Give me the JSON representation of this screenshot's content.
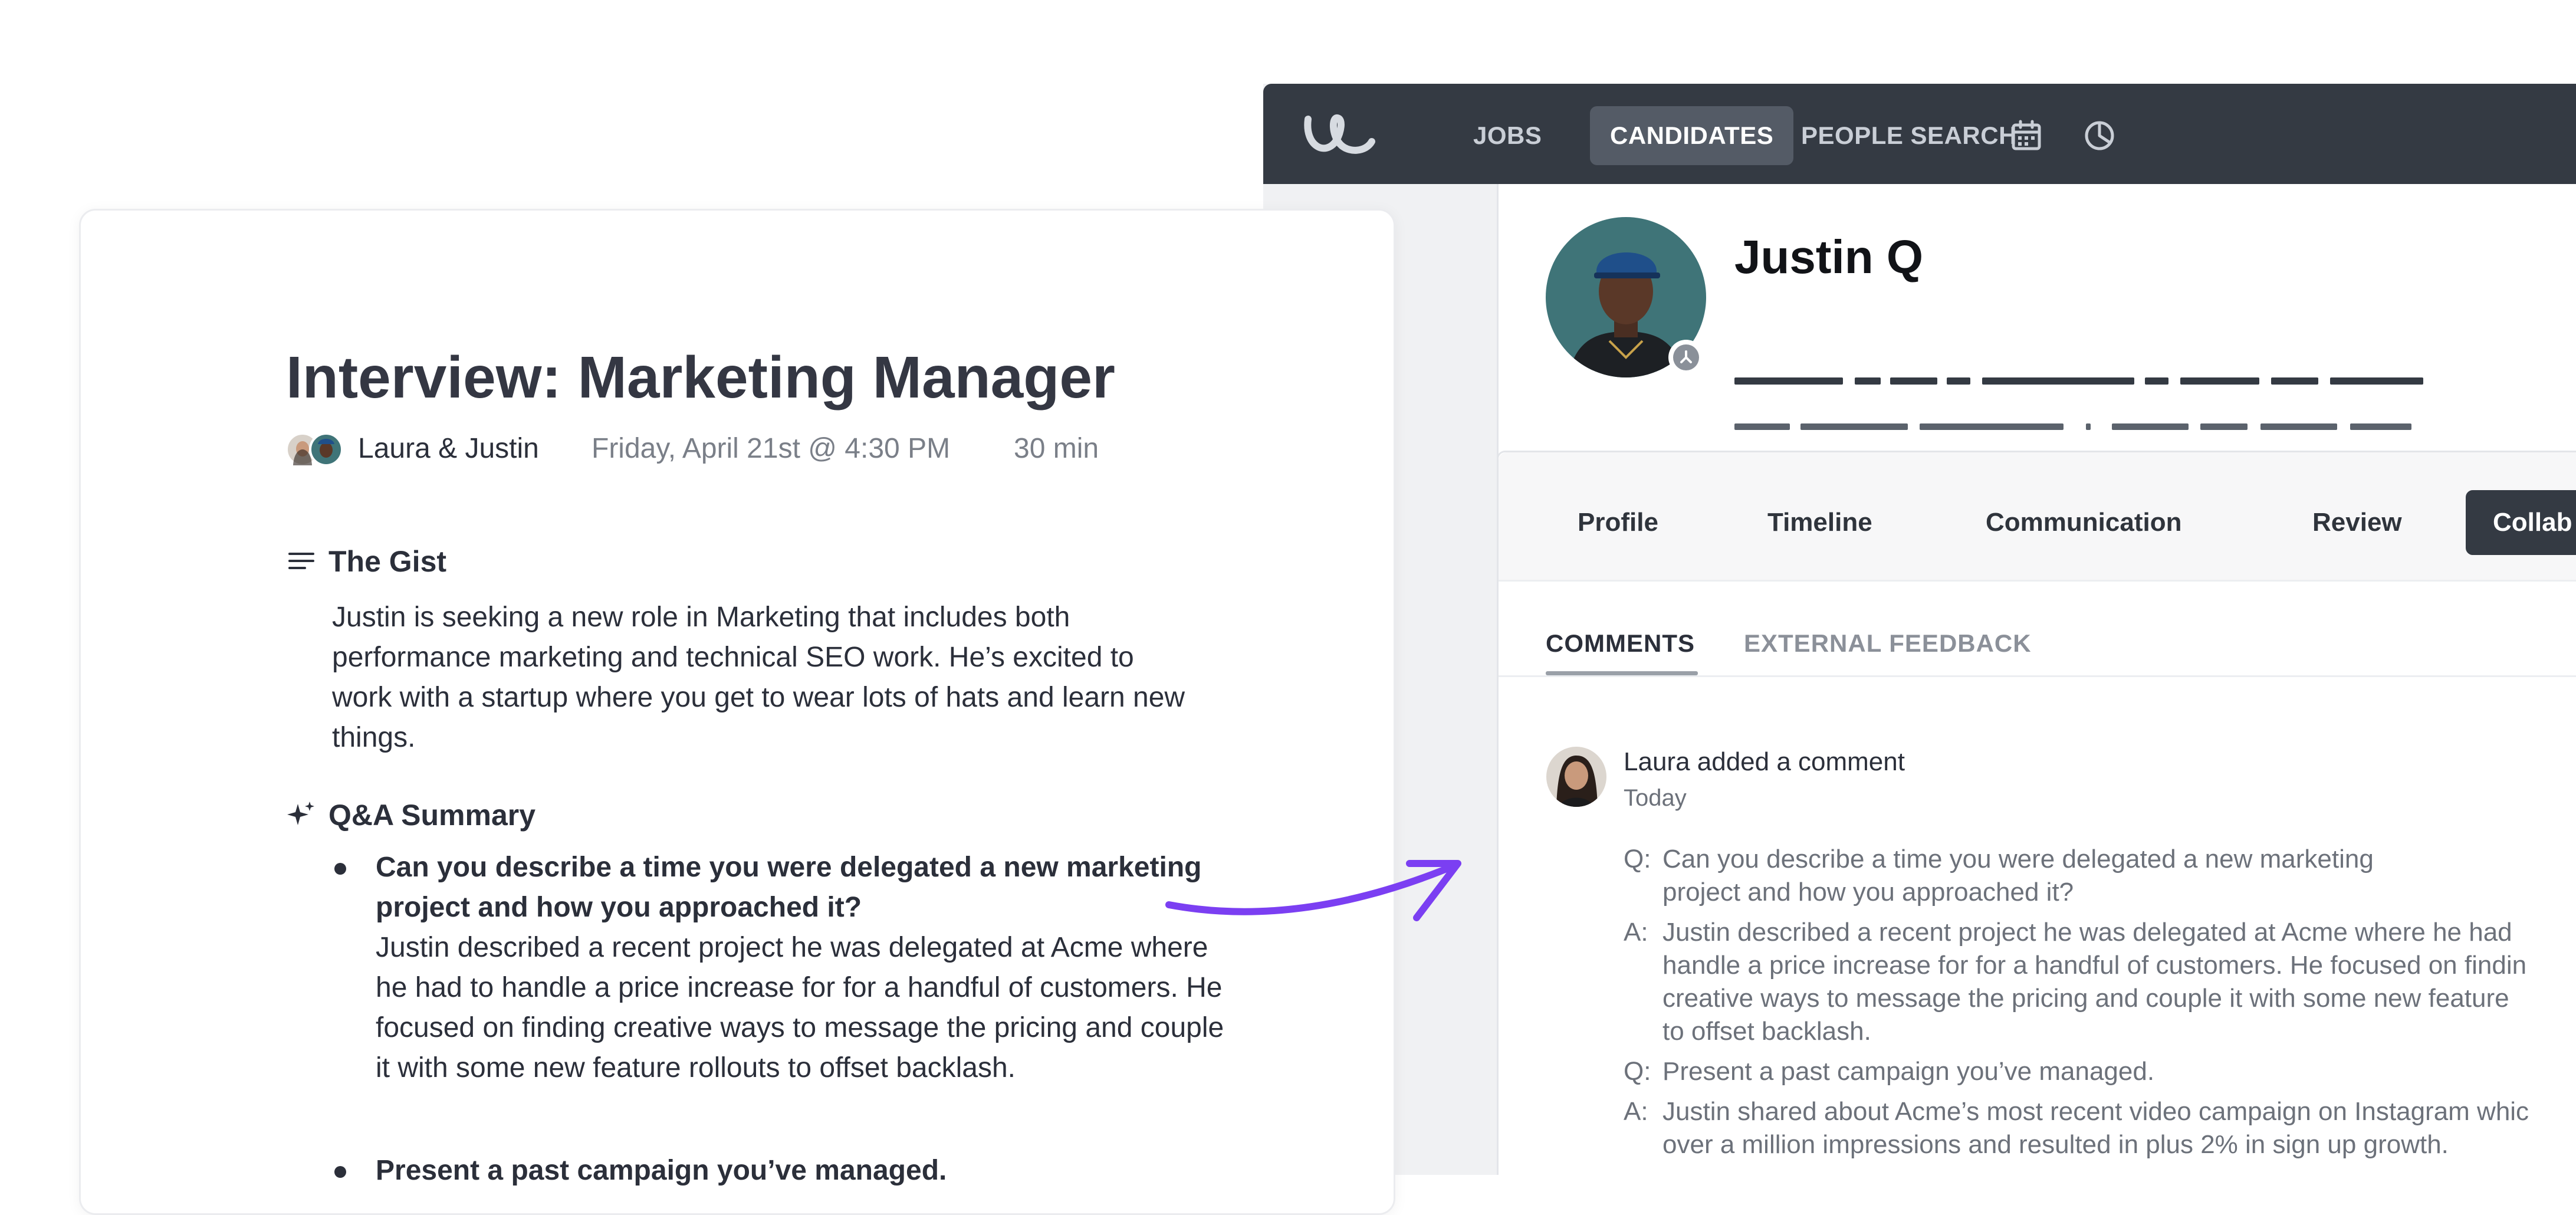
{
  "app": {
    "nav": {
      "items": [
        {
          "label": "JOBS"
        },
        {
          "label": "CANDIDATES",
          "active": true
        },
        {
          "label": "PEOPLE SEARCH"
        }
      ],
      "icons": [
        "calendar-icon",
        "pie-chart-icon"
      ]
    },
    "candidate": {
      "name": "Justin Q"
    },
    "tabs": [
      {
        "label": "Profile"
      },
      {
        "label": "Timeline"
      },
      {
        "label": "Communication"
      },
      {
        "label": "Review"
      },
      {
        "label": "Collab",
        "active": true
      }
    ],
    "subtabs": [
      {
        "label": "COMMENTS",
        "active": true
      },
      {
        "label": "EXTERNAL FEEDBACK"
      }
    ],
    "comment": {
      "author": "Laura added a comment",
      "time": "Today",
      "lines": [
        {
          "label": "Q:",
          "text": "Can you describe a time you were delegated a new marketing"
        },
        {
          "label": "",
          "text": "project and how you approached it?"
        },
        {
          "label": "A:",
          "text": "Justin described a recent project he was delegated at Acme where he had"
        },
        {
          "label": "",
          "text": "handle a price increase for for a handful of customers. He focused on findin"
        },
        {
          "label": "",
          "text": "creative ways to message the pricing and couple it with some new feature"
        },
        {
          "label": "",
          "text": "to offset backlash."
        },
        {
          "label": "Q:",
          "text": "Present a past campaign you’ve managed."
        },
        {
          "label": "A:",
          "text": "Justin shared about Acme’s most recent video campaign on Instagram whic"
        },
        {
          "label": "",
          "text": "over a million impressions and resulted in plus 2% in sign up growth."
        }
      ]
    }
  },
  "doc": {
    "title": "Interview: Marketing Manager",
    "people": "Laura & Justin",
    "date": "Friday, April 21st @ 4:30 PM",
    "duration": "30 min",
    "gist": {
      "heading": "The Gist",
      "text": "Justin is seeking a new role in Marketing that includes both performance marketing and technical SEO work. He’s excited to work with a startup where you get to wear lots of hats and learn new things."
    },
    "qa": {
      "heading": "Q&A Summary",
      "items": [
        {
          "question": "Can you describe a time you were delegated a new marketing project and how you approached it?",
          "answer": "Justin described a recent project he was delegated at Acme where he had to handle a price increase for for a handful of customers. He focused on finding creative ways to message the pricing and couple it with some new feature rollouts to offset backlash."
        },
        {
          "question": "Present a past campaign you’ve managed."
        }
      ]
    }
  },
  "colors": {
    "nav_bg": "#343a43",
    "active_tab": "#343a43",
    "arrow": "#7b3ff2"
  }
}
